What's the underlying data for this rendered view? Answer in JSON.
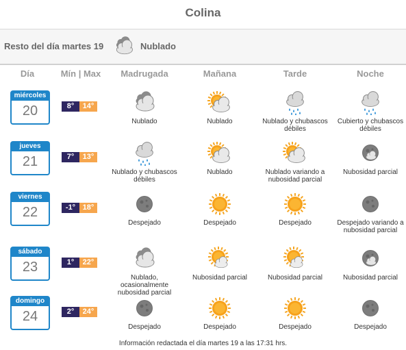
{
  "title": "Colina",
  "today": {
    "label": "Resto del día martes 19",
    "condition": "Nublado",
    "icon": "cloudy-icon"
  },
  "headers": [
    "Día",
    "Mín | Max",
    "Madrugada",
    "Mañana",
    "Tarde",
    "Noche"
  ],
  "rows": [
    {
      "weekday": "miércoles",
      "day": "20",
      "min": "8°",
      "max": "14°",
      "periods": [
        {
          "icon": "cloudy-icon",
          "text": "Nublado"
        },
        {
          "icon": "sun-cloudy-icon",
          "text": "Nublado"
        },
        {
          "icon": "cloud-rain-icon",
          "text": "Nublado y chubascos\ndébiles"
        },
        {
          "icon": "cloud-rain-icon",
          "text": "Cubierto y chubascos\ndébiles"
        }
      ]
    },
    {
      "weekday": "jueves",
      "day": "21",
      "min": "7°",
      "max": "13°",
      "periods": [
        {
          "icon": "cloud-rain-icon",
          "text": "Nublado y chubascos\ndébiles"
        },
        {
          "icon": "sun-cloudy-icon",
          "text": "Nublado"
        },
        {
          "icon": "sun-cloudy-icon",
          "text": "Nublado variando a\nnubosidad parcial"
        },
        {
          "icon": "moon-cloud-icon",
          "text": "Nubosidad parcial"
        }
      ]
    },
    {
      "weekday": "viernes",
      "day": "22",
      "min": "-1°",
      "max": "18°",
      "periods": [
        {
          "icon": "moon-icon",
          "text": "Despejado"
        },
        {
          "icon": "sun-icon",
          "text": "Despejado"
        },
        {
          "icon": "sun-icon",
          "text": "Despejado"
        },
        {
          "icon": "moon-icon",
          "text": "Despejado variando a\nnubosidad parcial"
        }
      ]
    },
    {
      "weekday": "sábado",
      "day": "23",
      "min": "1°",
      "max": "22°",
      "periods": [
        {
          "icon": "cloudy-icon",
          "text": "Nublado,\nocasionalmente\nnubosidad parcial"
        },
        {
          "icon": "sun-partly-icon",
          "text": "Nubosidad parcial"
        },
        {
          "icon": "sun-partly-icon",
          "text": "Nubosidad parcial"
        },
        {
          "icon": "moon-cloud-icon",
          "text": "Nubosidad parcial"
        }
      ]
    },
    {
      "weekday": "domingo",
      "day": "24",
      "min": "2°",
      "max": "24°",
      "periods": [
        {
          "icon": "moon-icon",
          "text": "Despejado"
        },
        {
          "icon": "sun-icon",
          "text": "Despejado"
        },
        {
          "icon": "sun-icon",
          "text": "Despejado"
        },
        {
          "icon": "moon-icon",
          "text": "Despejado"
        }
      ]
    }
  ],
  "footer": "Información redactada el día martes 19 a las 17:31 hrs."
}
